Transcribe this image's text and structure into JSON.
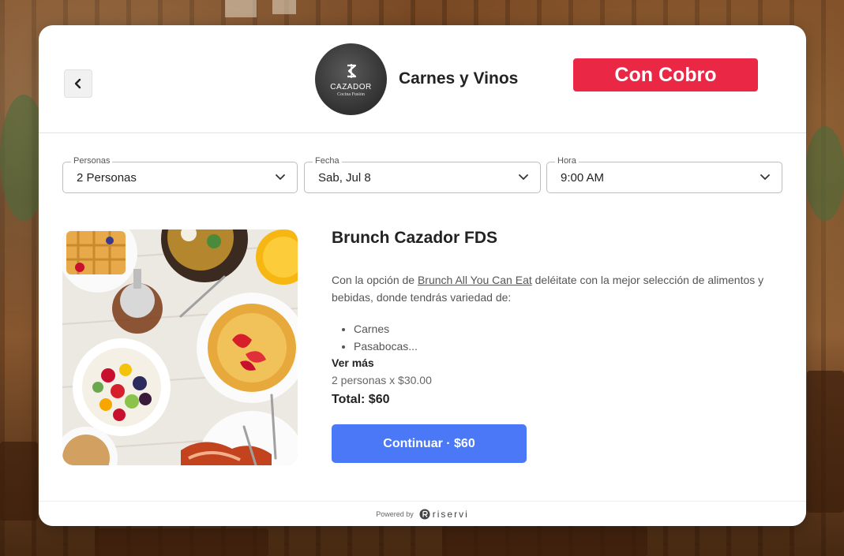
{
  "header": {
    "logo": {
      "name": "CAZADOR",
      "tagline": "Cocina Fusión"
    },
    "restaurant_name": "Carnes y Vinos",
    "payment_badge": "Con Cobro"
  },
  "selectors": {
    "people": {
      "label": "Personas",
      "value": "2 Personas"
    },
    "date": {
      "label": "Fecha",
      "value": "Sab, Jul 8"
    },
    "time": {
      "label": "Hora",
      "value": "9:00 AM"
    }
  },
  "product": {
    "title": "Brunch Cazador FDS",
    "description_prefix": "Con la opción de ",
    "description_link": "Brunch All You Can Eat",
    "description_suffix": " deléitate con la mejor selección de alimentos y bebidas, donde tendrás variedad de:",
    "items": [
      "Carnes",
      "Pasabocas..."
    ],
    "see_more": "Ver más",
    "calculation": "2 personas x $30.00",
    "total": "Total: $60",
    "cta": "Continuar · $60"
  },
  "footer": {
    "powered_by": "Powered by",
    "brand": "riservi"
  },
  "colors": {
    "badge": "#ea2845",
    "cta": "#4a78f6"
  }
}
